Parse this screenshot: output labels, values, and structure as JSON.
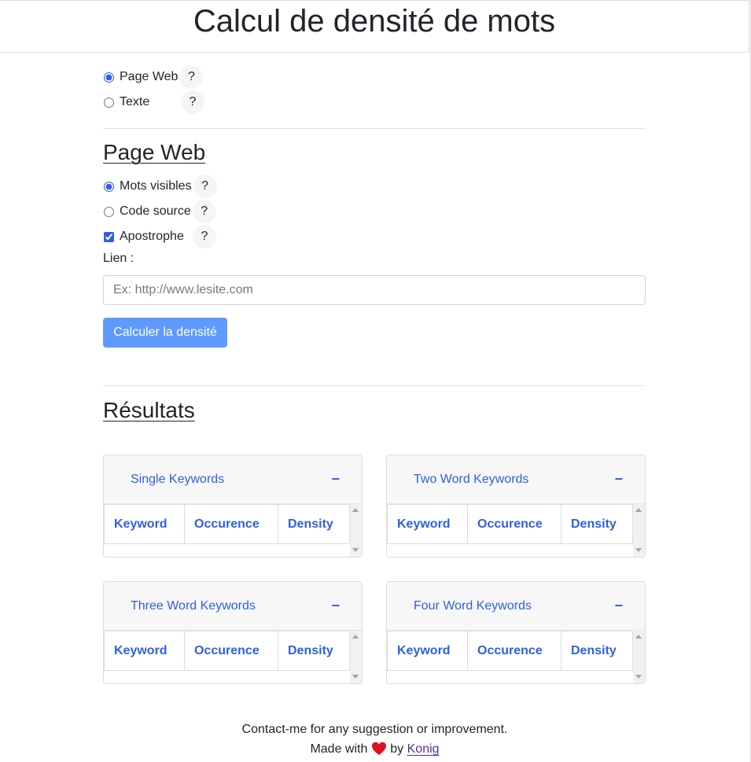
{
  "header": {
    "title": "Calcul de densité de mots"
  },
  "mode": {
    "options": [
      {
        "label": "Page Web",
        "checked": true,
        "help": "?"
      },
      {
        "label": "Texte",
        "checked": false,
        "help": "?"
      }
    ]
  },
  "webpage": {
    "title": "Page Web",
    "options": [
      {
        "label": "Mots visibles",
        "checked": true,
        "help": "?"
      },
      {
        "label": "Code source",
        "checked": false,
        "help": "?"
      }
    ],
    "apostrophe": {
      "label": "Apostrophe",
      "checked": true,
      "help": "?"
    },
    "link_label": "Lien :",
    "link_placeholder": "Ex: http://www.lesite.com",
    "link_value": "",
    "submit_label": "Calculer la densité"
  },
  "results": {
    "title": "Résultats",
    "columns": [
      "Keyword",
      "Occurence",
      "Density"
    ],
    "toggle": "−",
    "cards": [
      {
        "title": "Single Keywords"
      },
      {
        "title": "Two Word Keywords"
      },
      {
        "title": "Three Word Keywords"
      },
      {
        "title": "Four Word Keywords"
      }
    ]
  },
  "footer": {
    "line1": "Contact-me for any suggestion or improvement.",
    "made_with": "Made with",
    "by": "by",
    "author": "Konig",
    "heart_icon": "heart-icon",
    "heart_color": "#e0101e"
  },
  "colors": {
    "accent": "#2f5fe3",
    "button": "#5f9bff",
    "link": "#5b2d90"
  }
}
